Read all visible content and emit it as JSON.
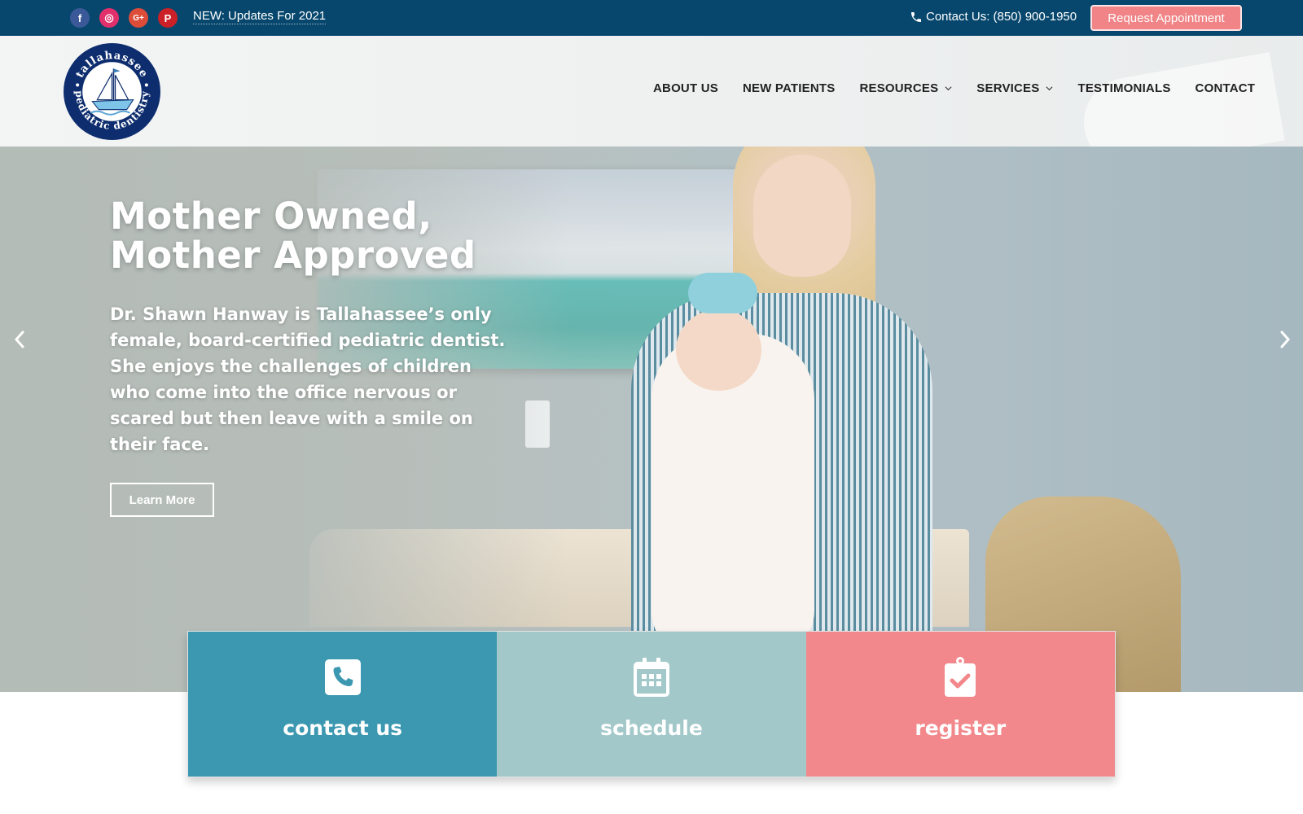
{
  "topbar": {
    "social": [
      {
        "name": "facebook",
        "glyph": "f",
        "color": "#3b5998"
      },
      {
        "name": "instagram",
        "glyph": "◎",
        "color": "#e1306c"
      },
      {
        "name": "google-plus",
        "glyph": "G+",
        "color": "#dd4b39"
      },
      {
        "name": "pinterest",
        "glyph": "P",
        "color": "#cb2027"
      }
    ],
    "news_link": "NEW: Updates For 2021",
    "contact_text": "Contact Us: (850) 900-1950",
    "request_button": "Request Appointment",
    "background": "#07476d",
    "accent": "#f08486"
  },
  "header": {
    "logo": {
      "top_text": "tallahassee",
      "bottom_text": "pediatric dentistry",
      "ring_color": "#0d2d6e"
    },
    "nav": [
      {
        "label": "ABOUT US",
        "has_dropdown": false
      },
      {
        "label": "NEW PATIENTS",
        "has_dropdown": false
      },
      {
        "label": "RESOURCES",
        "has_dropdown": true
      },
      {
        "label": "SERVICES",
        "has_dropdown": true
      },
      {
        "label": "TESTIMONIALS",
        "has_dropdown": false
      },
      {
        "label": "CONTACT",
        "has_dropdown": false
      }
    ]
  },
  "hero": {
    "title_line1": "Mother Owned,",
    "title_line2": "Mother Approved",
    "text": "Dr. Shawn Hanway is Tallahassee’s only female, board-certified pediatric dentist. She enjoys the challenges of children who come into the office nervous or scared but then leave with a smile on their face.",
    "button": "Learn More"
  },
  "cta": [
    {
      "label": "contact us",
      "icon": "phone-icon",
      "color": "#3b98b0"
    },
    {
      "label": "schedule",
      "icon": "calendar-icon",
      "color": "#a3c8c9"
    },
    {
      "label": "register",
      "icon": "clipboard-check-icon",
      "color": "#f2888b"
    }
  ]
}
